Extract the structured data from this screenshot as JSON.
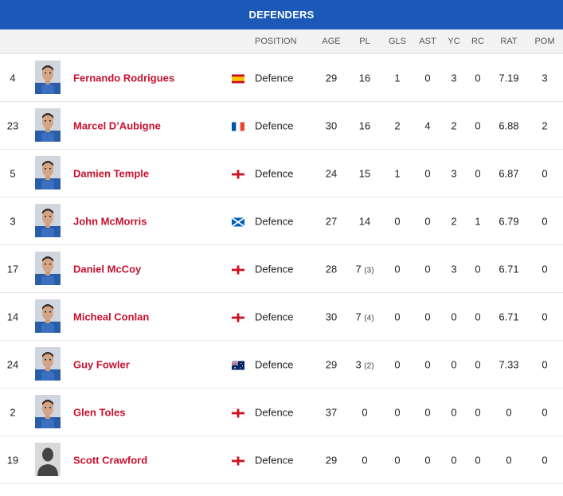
{
  "header": {
    "title": "DEFENDERS"
  },
  "columns": {
    "position": "POSITION",
    "age": "AGE",
    "pl": "PL",
    "gls": "GLS",
    "ast": "AST",
    "yc": "YC",
    "rc": "RC",
    "rat": "RAT",
    "pom": "POM"
  },
  "players": [
    {
      "number": "4",
      "name": "Fernando Rodrigues",
      "flag": "spain",
      "position": "Defence",
      "age": "29",
      "pl": "16",
      "pl_sub": "",
      "gls": "1",
      "ast": "0",
      "yc": "3",
      "rc": "0",
      "rat": "7.19",
      "pom": "3",
      "avatar": "photo"
    },
    {
      "number": "23",
      "name": "Marcel D’Aubigne",
      "flag": "france",
      "position": "Defence",
      "age": "30",
      "pl": "16",
      "pl_sub": "",
      "gls": "2",
      "ast": "4",
      "yc": "2",
      "rc": "0",
      "rat": "6.88",
      "pom": "2",
      "avatar": "photo"
    },
    {
      "number": "5",
      "name": "Damien Temple",
      "flag": "england",
      "position": "Defence",
      "age": "24",
      "pl": "15",
      "pl_sub": "",
      "gls": "1",
      "ast": "0",
      "yc": "3",
      "rc": "0",
      "rat": "6.87",
      "pom": "0",
      "avatar": "photo"
    },
    {
      "number": "3",
      "name": "John McMorris",
      "flag": "scotland",
      "position": "Defence",
      "age": "27",
      "pl": "14",
      "pl_sub": "",
      "gls": "0",
      "ast": "0",
      "yc": "2",
      "rc": "1",
      "rat": "6.79",
      "pom": "0",
      "avatar": "photo"
    },
    {
      "number": "17",
      "name": "Daniel McCoy",
      "flag": "england",
      "position": "Defence",
      "age": "28",
      "pl": "7",
      "pl_sub": "(3)",
      "gls": "0",
      "ast": "0",
      "yc": "3",
      "rc": "0",
      "rat": "6.71",
      "pom": "0",
      "avatar": "photo"
    },
    {
      "number": "14",
      "name": "Micheal Conlan",
      "flag": "england",
      "position": "Defence",
      "age": "30",
      "pl": "7",
      "pl_sub": "(4)",
      "gls": "0",
      "ast": "0",
      "yc": "0",
      "rc": "0",
      "rat": "6.71",
      "pom": "0",
      "avatar": "photo"
    },
    {
      "number": "24",
      "name": "Guy Fowler",
      "flag": "australia",
      "position": "Defence",
      "age": "29",
      "pl": "3",
      "pl_sub": "(2)",
      "gls": "0",
      "ast": "0",
      "yc": "0",
      "rc": "0",
      "rat": "7.33",
      "pom": "0",
      "avatar": "photo"
    },
    {
      "number": "2",
      "name": "Glen Toles",
      "flag": "england",
      "position": "Defence",
      "age": "37",
      "pl": "0",
      "pl_sub": "",
      "gls": "0",
      "ast": "0",
      "yc": "0",
      "rc": "0",
      "rat": "0",
      "pom": "0",
      "avatar": "photo"
    },
    {
      "number": "19",
      "name": "Scott Crawford",
      "flag": "england",
      "position": "Defence",
      "age": "29",
      "pl": "0",
      "pl_sub": "",
      "gls": "0",
      "ast": "0",
      "yc": "0",
      "rc": "0",
      "rat": "0",
      "pom": "0",
      "avatar": "placeholder"
    }
  ],
  "colors": {
    "header_bg": "#1b58b8",
    "name": "#c8102e",
    "kit": "#2a5da8"
  }
}
